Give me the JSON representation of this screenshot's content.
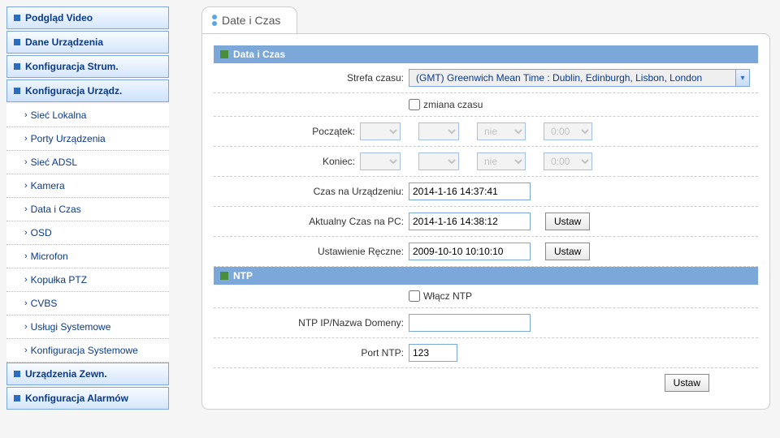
{
  "sidebar": {
    "items": [
      {
        "label": "Podgląd Video"
      },
      {
        "label": "Dane Urządzenia"
      },
      {
        "label": "Konfiguracja Strum."
      },
      {
        "label": "Konfiguracja Urządz.",
        "active": true
      },
      {
        "label": "Urządzenia Zewn."
      },
      {
        "label": "Konfiguracja Alarmów"
      }
    ],
    "sub": [
      "Sieć Lokalna",
      "Porty Urządzenia",
      "Sieć ADSL",
      "Kamera",
      "Data i Czas",
      "OSD",
      "Microfon",
      "Kopułka PTZ",
      "CVBS",
      "Usługi Systemowe",
      "Konfiguracja Systemowe"
    ]
  },
  "tab_title": "Date i Czas",
  "section1": {
    "title": "Data i Czas",
    "tz_label": "Strefa czasu:",
    "tz_value": "(GMT) Greenwich Mean Time : Dublin, Edinburgh, Lisbon, London",
    "dst_label": "zmiana czasu",
    "start_label": "Początek:",
    "end_label": "Koniec:",
    "sel_nie": "nie",
    "sel_time": "0:00",
    "device_time_label": "Czas na Urządzeniu:",
    "device_time_value": "2014-1-16 14:37:41",
    "pc_time_label": "Aktualny Czas na PC:",
    "pc_time_value": "2014-1-16 14:38:12",
    "manual_label": "Ustawienie Ręczne:",
    "manual_value": "2009-10-10 10:10:10",
    "set_btn": "Ustaw"
  },
  "section2": {
    "title": "NTP",
    "enable_label": "Włącz NTP",
    "ip_label": "NTP IP/Nazwa Domeny:",
    "ip_value": "",
    "port_label": "Port NTP:",
    "port_value": "123",
    "set_btn": "Ustaw"
  }
}
